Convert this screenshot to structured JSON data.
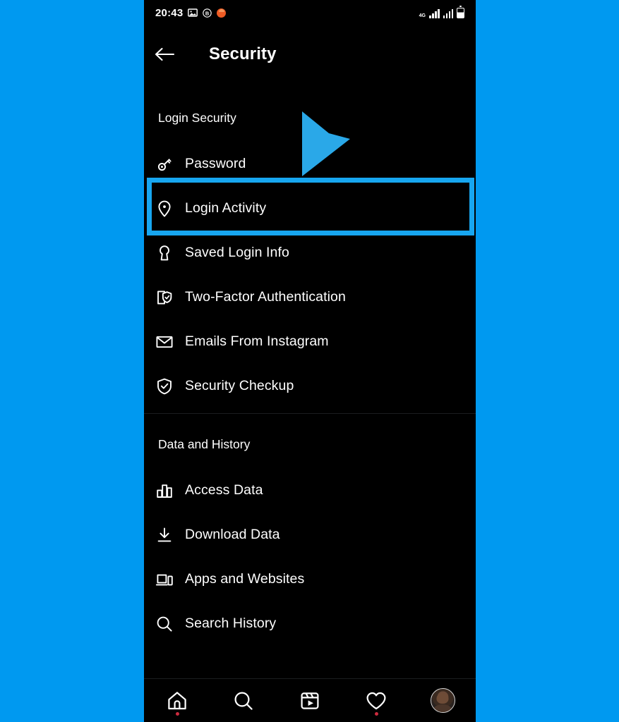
{
  "annotation": {
    "background_color": "#0099f0",
    "highlight_color": "#17a6f0",
    "highlight_target": "Login Activity",
    "cursor_icon": "blue-arrow-cursor"
  },
  "statusbar": {
    "time": "20:43",
    "left_icons": [
      "image-icon",
      "circled-b-icon",
      "orange-dot-icon"
    ],
    "network_label": "4G",
    "right_icons": [
      "signal-bars-icon",
      "signal-bars-icon",
      "battery-icon"
    ]
  },
  "appbar": {
    "back_icon": "back-arrow-icon",
    "title": "Security"
  },
  "sections": [
    {
      "id": "login_security",
      "header": "Login Security",
      "items": [
        {
          "label": "Password",
          "icon": "key-icon"
        },
        {
          "label": "Login Activity",
          "icon": "location-pin-icon",
          "highlighted": true
        },
        {
          "label": "Saved Login Info",
          "icon": "keyhole-icon"
        },
        {
          "label": "Two-Factor Authentication",
          "icon": "phone-shield-check-icon"
        },
        {
          "label": "Emails From Instagram",
          "icon": "envelope-icon"
        },
        {
          "label": "Security Checkup",
          "icon": "shield-check-icon"
        }
      ]
    },
    {
      "id": "data_and_history",
      "header": "Data and History",
      "items": [
        {
          "label": "Access Data",
          "icon": "bar-chart-icon"
        },
        {
          "label": "Download Data",
          "icon": "download-arrow-icon"
        },
        {
          "label": "Apps and Websites",
          "icon": "laptop-phone-icon"
        },
        {
          "label": "Search History",
          "icon": "magnifier-icon"
        }
      ]
    }
  ],
  "bottomnav": {
    "items": [
      {
        "name": "home",
        "icon": "home-icon",
        "badge_dot": true
      },
      {
        "name": "search",
        "icon": "magnifier-icon",
        "badge_dot": false
      },
      {
        "name": "reels",
        "icon": "reels-icon",
        "badge_dot": false
      },
      {
        "name": "activity",
        "icon": "heart-icon",
        "badge_dot": true
      },
      {
        "name": "profile",
        "icon": "avatar-icon",
        "badge_dot": false
      }
    ]
  }
}
